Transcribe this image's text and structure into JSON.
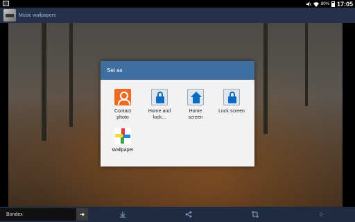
{
  "status_bar": {
    "battery_percent": "80%",
    "time": "17:05",
    "icons": [
      "notification-icon",
      "mute-icon",
      "wifi-icon",
      "battery-icon"
    ]
  },
  "action_bar": {
    "app_icon": "music-wallpapers-app-icon",
    "title": "Music wallpapers"
  },
  "dialog": {
    "title": "Set as",
    "items": [
      {
        "label": "Contact\nphoto",
        "icon": "contact-photo-icon"
      },
      {
        "label": "Home and\nlock...",
        "icon": "lock-icon"
      },
      {
        "label": "Home\nscreen",
        "icon": "home-icon"
      },
      {
        "label": "Lock screen",
        "icon": "lock-icon"
      },
      {
        "label": "Wallpaper",
        "icon": "pinwheel-icon"
      }
    ]
  },
  "bottom_bar": {
    "search_value": "Bondex",
    "go_icon": "arrow-right-icon",
    "actions": [
      "download-icon",
      "share-icon",
      "crop-icon",
      "star-icon"
    ]
  },
  "colors": {
    "action_bar": "#25304a",
    "dialog_header": "#3f6ea0",
    "bottom_bar": "#1f2b40"
  }
}
